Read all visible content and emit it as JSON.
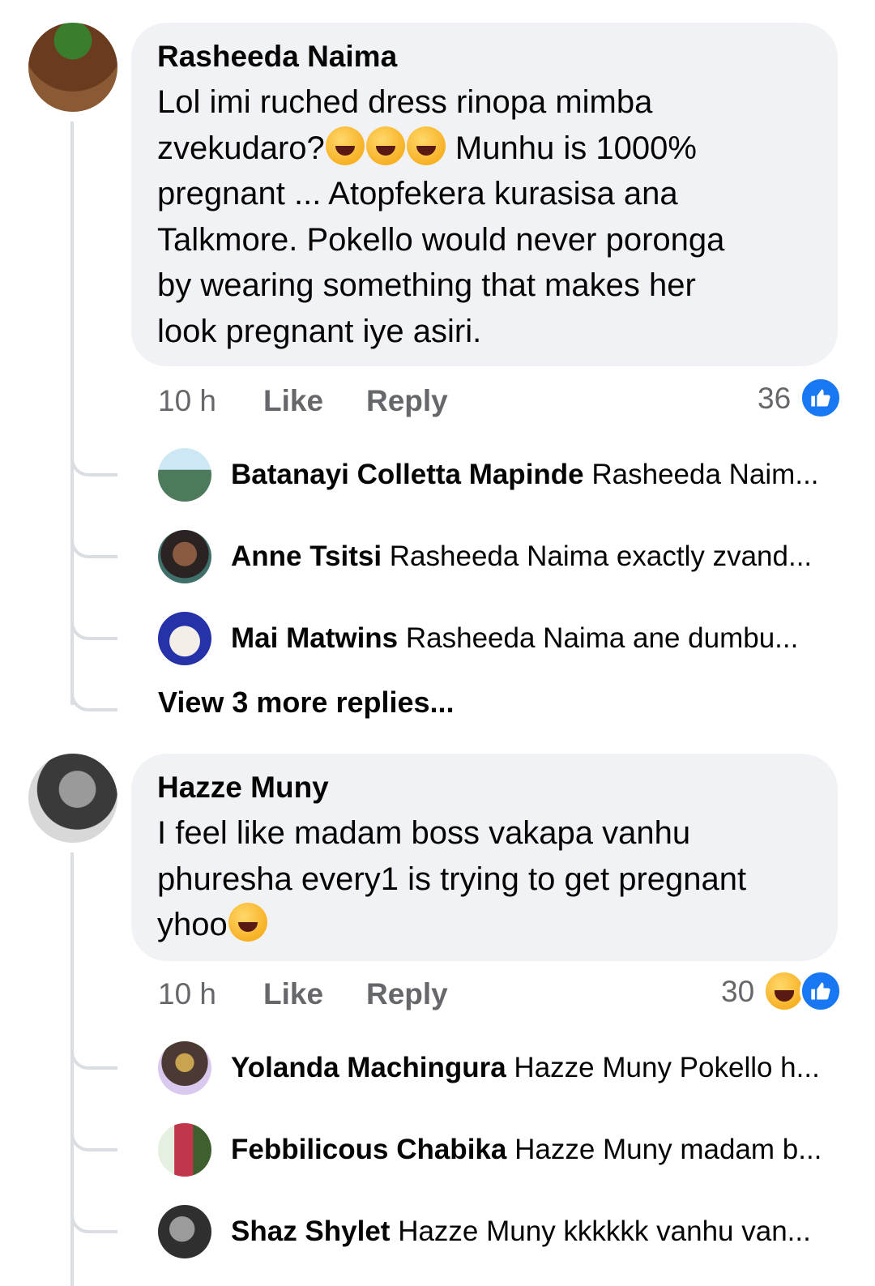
{
  "comments": [
    {
      "author": "Rasheeda Naima",
      "lines": [
        "Lol imi ruched dress rinopa mimba",
        "zvekudaro?",
        " Munhu is 1000%",
        "pregnant ... Atopfekera kurasisa ana",
        "Talkmore. Pokello would never poronga",
        "by wearing something that makes her",
        "look pregnant iye asiri."
      ],
      "emoji_name": "laughing-crying-emoji",
      "time": "10 h",
      "like_label": "Like",
      "reply_label": "Reply",
      "reaction_count": "36",
      "reactions": [
        "like-icon"
      ],
      "replies": [
        {
          "name": "Batanayi Colletta Mapinde",
          "text": "Rasheeda Naim..."
        },
        {
          "name": "Anne Tsitsi",
          "text": "Rasheeda Naima exactly zvand..."
        },
        {
          "name": "Mai Matwins",
          "text": "Rasheeda Naima  ane dumbu..."
        }
      ],
      "view_more": "View 3 more replies..."
    },
    {
      "author": "Hazze Muny",
      "lines": [
        "I feel like madam boss vakapa vanhu",
        "phuresha every1 is trying to get pregnant",
        "yhoo"
      ],
      "emoji_name": "laughing-crying-emoji",
      "time": "10 h",
      "like_label": "Like",
      "reply_label": "Reply",
      "reaction_count": "30",
      "reactions": [
        "haha-icon",
        "like-icon"
      ],
      "replies": [
        {
          "name": "Yolanda Machingura",
          "text": "Hazze Muny Pokello h..."
        },
        {
          "name": "Febbilicous Chabika",
          "text": "Hazze Muny madam b..."
        },
        {
          "name": "Shaz Shylet",
          "text": "Hazze Muny kkkkkk vanhu van..."
        }
      ]
    }
  ],
  "colors": {
    "bubble": "#f0f2f5",
    "meta_text": "#65676b",
    "like_blue": "#1877f2",
    "thread_line": "#dadde1"
  }
}
